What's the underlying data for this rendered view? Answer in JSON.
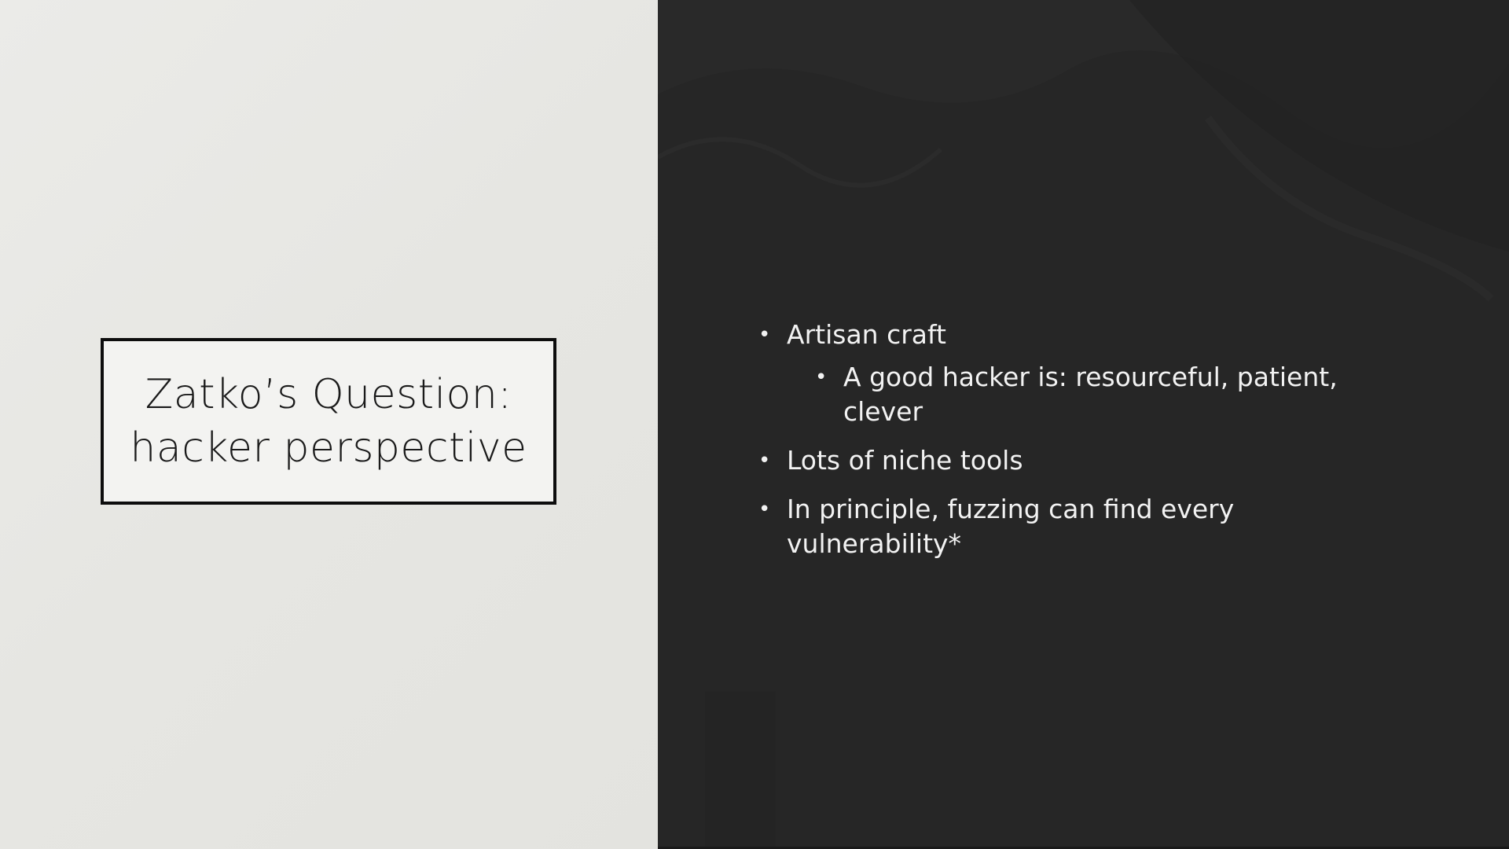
{
  "slide": {
    "title_lines": [
      "Zatko’s Question:",
      "hacker perspective"
    ],
    "bullets": [
      {
        "text": "Artisan craft",
        "level": 1
      },
      {
        "text": "A good hacker is: resourceful, patient, clever",
        "level": 2
      },
      {
        "text": "Lots of niche tools",
        "level": 1
      },
      {
        "text": "In principle, fuzzing can find every vulnerability*",
        "level": 1
      }
    ],
    "bullet_glyph": "•"
  },
  "colors": {
    "left_background": "#e6e6e2",
    "right_background": "#262626",
    "title_border": "#0d0d0d",
    "title_text": "#1a1a1a",
    "bullet_text": "#f2f2f2"
  }
}
